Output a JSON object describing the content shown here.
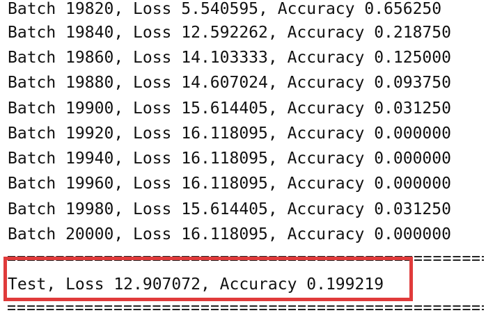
{
  "log_lines": [
    "Batch 19820, Loss 5.540595, Accuracy 0.656250",
    "Batch 19840, Loss 12.592262, Accuracy 0.218750",
    "Batch 19860, Loss 14.103333, Accuracy 0.125000",
    "Batch 19880, Loss 14.607024, Accuracy 0.093750",
    "Batch 19900, Loss 15.614405, Accuracy 0.031250",
    "Batch 19920, Loss 16.118095, Accuracy 0.000000",
    "Batch 19940, Loss 16.118095, Accuracy 0.000000",
    "Batch 19960, Loss 16.118095, Accuracy 0.000000",
    "Batch 19980, Loss 15.614405, Accuracy 0.031250",
    "Batch 20000, Loss 16.118095, Accuracy 0.000000"
  ],
  "test_result": "Test, Loss 12.907072, Accuracy 0.199219",
  "colors": {
    "text": "#111111",
    "highlight_border": "#e03b3b",
    "background": "#ffffff"
  }
}
